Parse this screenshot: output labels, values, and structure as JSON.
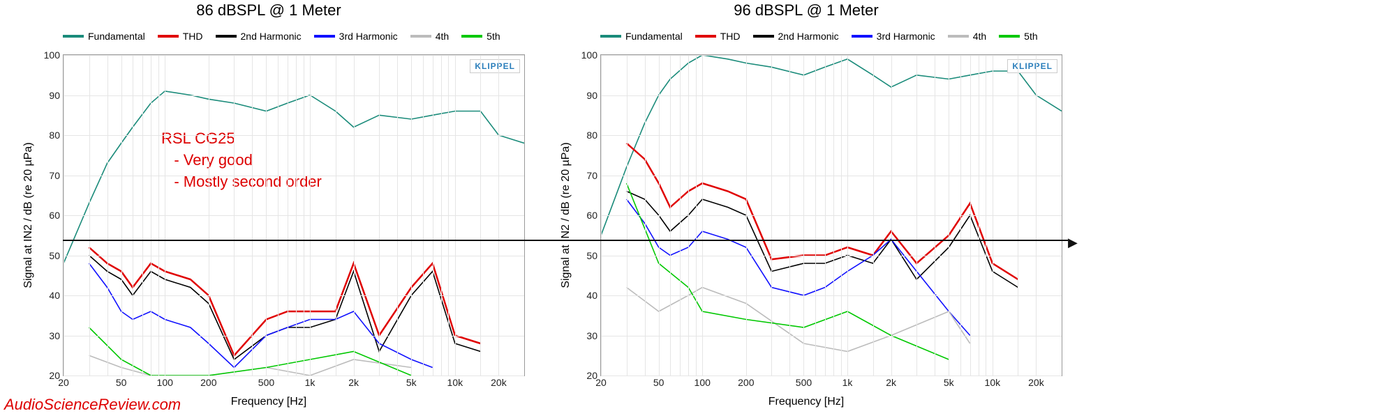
{
  "colors": {
    "Fundamental": "#1a8b7a",
    "THD": "#e00000",
    "2nd Harmonic": "#000000",
    "3rd Harmonic": "#1010ff",
    "4th": "#bcbcbc",
    "5th": "#00c800"
  },
  "legend_labels": [
    "Fundamental",
    "THD",
    "2nd Harmonic",
    "3rd Harmonic",
    "4th",
    "5th"
  ],
  "left": {
    "title": "86 dBSPL @ 1 Meter",
    "xlabel": "Frequency [Hz]",
    "ylabel": "Signal at IN2 / dB (re 20 µPa)",
    "annotation_title": "RSL CG25",
    "annotation_line1": "- Very good",
    "annotation_line2": "- Mostly second order",
    "watermark": "KLIPPEL"
  },
  "right": {
    "title": "96 dBSPL @ 1 Meter",
    "xlabel": "Frequency [Hz]",
    "ylabel": "Signal at IN2 / dB (re 20 µPa)",
    "watermark": "KLIPPEL"
  },
  "footer": "AudioScienceReview.com",
  "axis": {
    "xmin": 20,
    "xmax": 30000,
    "ymin": 20,
    "ymax": 100,
    "y_ticks": [
      20,
      30,
      40,
      50,
      60,
      70,
      80,
      90,
      100
    ],
    "x_ticks": [
      20,
      50,
      100,
      200,
      500,
      1000,
      2000,
      5000,
      10000,
      20000
    ],
    "x_tick_labels": [
      "20",
      "50",
      "100",
      "200",
      "500",
      "1k",
      "2k",
      "5k",
      "10k",
      "20k"
    ]
  },
  "reference_line_db": 50,
  "chart_data": [
    {
      "type": "line",
      "title": "86 dBSPL @ 1 Meter",
      "xscale": "log",
      "xlabel": "Frequency [Hz]",
      "ylabel": "Signal at IN2 / dB (re 20 µPa)",
      "ylim": [
        20,
        100
      ],
      "series": [
        {
          "name": "Fundamental",
          "x": [
            20,
            30,
            40,
            50,
            60,
            80,
            100,
            150,
            200,
            300,
            500,
            700,
            1000,
            1500,
            2000,
            3000,
            5000,
            7000,
            10000,
            15000,
            20000,
            30000
          ],
          "y": [
            48,
            63,
            73,
            78,
            82,
            88,
            91,
            90,
            89,
            88,
            86,
            88,
            90,
            86,
            82,
            85,
            84,
            85,
            86,
            86,
            80,
            78
          ]
        },
        {
          "name": "THD",
          "x": [
            30,
            40,
            50,
            60,
            80,
            100,
            150,
            200,
            300,
            500,
            700,
            1000,
            1500,
            2000,
            3000,
            5000,
            7000,
            10000,
            15000
          ],
          "y": [
            52,
            48,
            46,
            42,
            48,
            46,
            44,
            40,
            25,
            34,
            36,
            36,
            36,
            48,
            30,
            42,
            48,
            30,
            28
          ]
        },
        {
          "name": "2nd Harmonic",
          "x": [
            30,
            40,
            50,
            60,
            80,
            100,
            150,
            200,
            300,
            500,
            700,
            1000,
            1500,
            2000,
            3000,
            5000,
            7000,
            10000,
            15000
          ],
          "y": [
            50,
            46,
            44,
            40,
            46,
            44,
            42,
            38,
            24,
            30,
            32,
            32,
            34,
            46,
            26,
            40,
            46,
            28,
            26
          ]
        },
        {
          "name": "3rd Harmonic",
          "x": [
            30,
            40,
            50,
            60,
            80,
            100,
            150,
            200,
            300,
            500,
            700,
            1000,
            1500,
            2000,
            3000,
            5000,
            7000
          ],
          "y": [
            48,
            42,
            36,
            34,
            36,
            34,
            32,
            28,
            22,
            30,
            32,
            34,
            34,
            36,
            28,
            24,
            22
          ]
        },
        {
          "name": "4th",
          "x": [
            30,
            50,
            80,
            100,
            200,
            500,
            1000,
            2000,
            5000
          ],
          "y": [
            25,
            22,
            20,
            20,
            20,
            22,
            20,
            24,
            22
          ]
        },
        {
          "name": "5th",
          "x": [
            30,
            50,
            80,
            100,
            200,
            500,
            1000,
            2000,
            5000
          ],
          "y": [
            32,
            24,
            20,
            20,
            20,
            22,
            24,
            26,
            20
          ]
        }
      ]
    },
    {
      "type": "line",
      "title": "96 dBSPL @ 1 Meter",
      "xscale": "log",
      "xlabel": "Frequency [Hz]",
      "ylabel": "Signal at IN2 / dB (re 20 µPa)",
      "ylim": [
        20,
        100
      ],
      "series": [
        {
          "name": "Fundamental",
          "x": [
            20,
            30,
            40,
            50,
            60,
            80,
            100,
            150,
            200,
            300,
            500,
            700,
            1000,
            1500,
            2000,
            3000,
            5000,
            7000,
            10000,
            15000,
            20000,
            30000
          ],
          "y": [
            55,
            72,
            83,
            90,
            94,
            98,
            100,
            99,
            98,
            97,
            95,
            97,
            99,
            95,
            92,
            95,
            94,
            95,
            96,
            96,
            90,
            86
          ]
        },
        {
          "name": "THD",
          "x": [
            30,
            40,
            50,
            60,
            80,
            100,
            150,
            200,
            300,
            500,
            700,
            1000,
            1500,
            2000,
            3000,
            5000,
            7000,
            10000,
            15000
          ],
          "y": [
            78,
            74,
            68,
            62,
            66,
            68,
            66,
            64,
            49,
            50,
            50,
            52,
            50,
            56,
            48,
            55,
            63,
            48,
            44
          ]
        },
        {
          "name": "2nd Harmonic",
          "x": [
            30,
            40,
            50,
            60,
            80,
            100,
            150,
            200,
            300,
            500,
            700,
            1000,
            1500,
            2000,
            3000,
            5000,
            7000,
            10000,
            15000
          ],
          "y": [
            66,
            64,
            60,
            56,
            60,
            64,
            62,
            60,
            46,
            48,
            48,
            50,
            48,
            54,
            44,
            52,
            60,
            46,
            42
          ]
        },
        {
          "name": "3rd Harmonic",
          "x": [
            30,
            40,
            50,
            60,
            80,
            100,
            150,
            200,
            300,
            500,
            700,
            1000,
            1500,
            2000,
            3000,
            5000,
            7000
          ],
          "y": [
            64,
            58,
            52,
            50,
            52,
            56,
            54,
            52,
            42,
            40,
            42,
            46,
            50,
            54,
            46,
            36,
            30
          ]
        },
        {
          "name": "4th",
          "x": [
            30,
            50,
            80,
            100,
            200,
            500,
            1000,
            2000,
            5000,
            7000
          ],
          "y": [
            42,
            36,
            40,
            42,
            38,
            28,
            26,
            30,
            36,
            28
          ]
        },
        {
          "name": "5th",
          "x": [
            30,
            50,
            80,
            100,
            200,
            500,
            1000,
            2000,
            5000
          ],
          "y": [
            68,
            48,
            42,
            36,
            34,
            32,
            36,
            30,
            24
          ]
        }
      ]
    }
  ]
}
